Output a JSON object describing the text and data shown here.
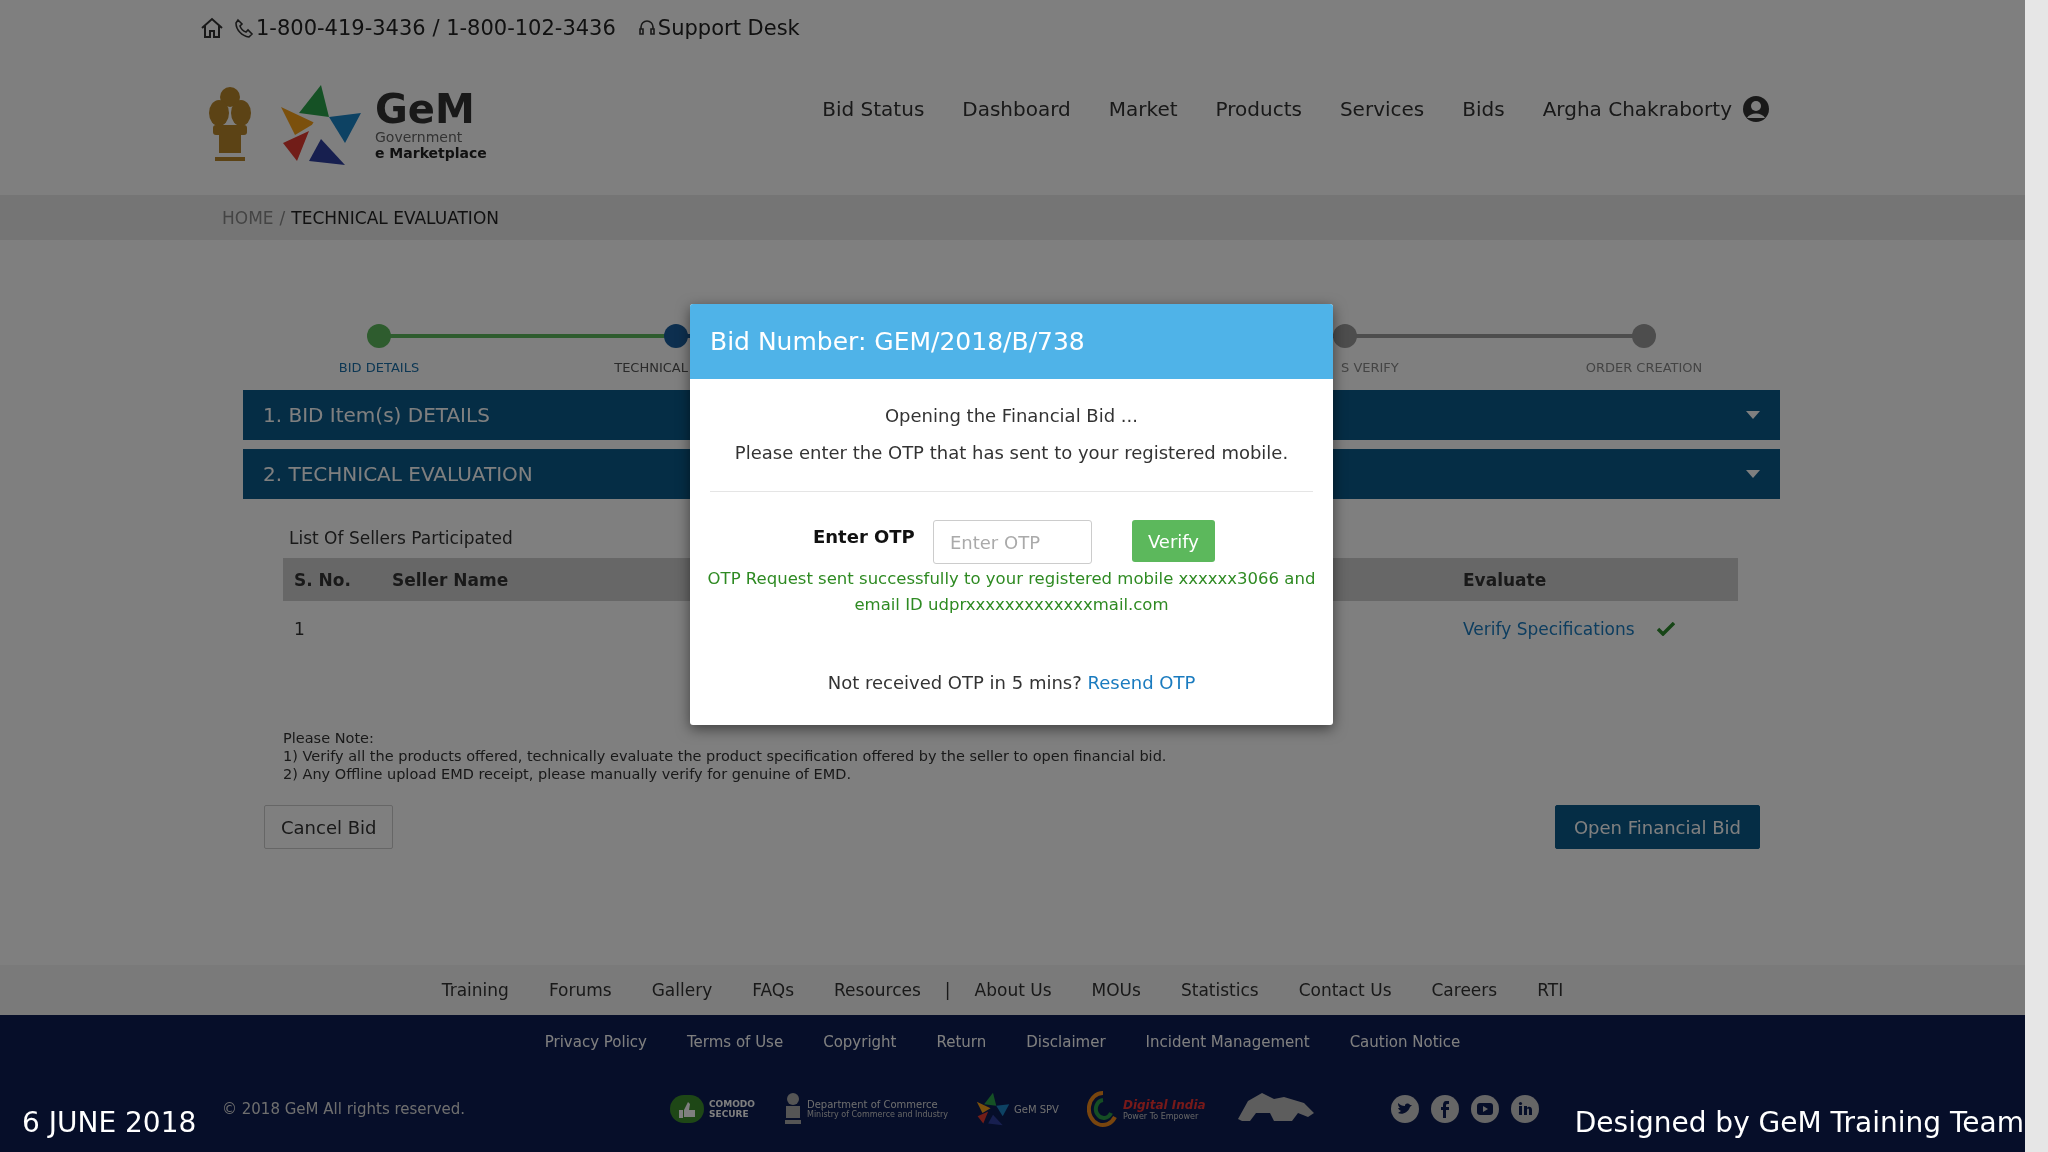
{
  "top_bar": {
    "phone": "1-800-419-3436 / 1-800-102-3436",
    "support": "Support Desk"
  },
  "logo": {
    "title": "GeM",
    "line_1": "Government",
    "line_2": "e Marketplace"
  },
  "nav": {
    "items": [
      "Bid Status",
      "Dashboard",
      "Market",
      "Products",
      "Services",
      "Bids"
    ],
    "user": "Argha Chakraborty"
  },
  "breadcrumb": {
    "separator": "/",
    "items": [
      {
        "label": "HOME",
        "current": false
      },
      {
        "label": "TECHNICAL EVALUATION",
        "current": true
      }
    ]
  },
  "stepper": [
    {
      "label": "BID DETAILS",
      "done": true,
      "current": false
    },
    {
      "label": "TECHNICAL",
      "done": false,
      "current": true
    },
    {
      "label": "S VERIFY",
      "done": false,
      "current": false
    },
    {
      "label": "ORDER CREATION",
      "done": false,
      "current": false
    }
  ],
  "sections": [
    "1. BID Item(s) DETAILS",
    "2. TECHNICAL EVALUATION"
  ],
  "sellers": {
    "title": "List Of Sellers Participated",
    "columns": [
      "S. No.",
      "Seller Name",
      "Evaluate"
    ],
    "rows": [
      {
        "s_no": "1",
        "evaluate": "Verify Specifications",
        "verified": true
      }
    ]
  },
  "notes": [
    "Please Note:",
    "1) Verify all the products offered, technically evaluate the product specification offered by the seller to open financial bid.",
    "2) Any Offline upload EMD receipt, please manually verify for genuine of EMD."
  ],
  "buttons": {
    "cancel": "Cancel Bid",
    "open": "Open Financial Bid"
  },
  "footer_links": [
    {
      "label": "Training",
      "kind": "link"
    },
    {
      "label": "Forums",
      "kind": "link"
    },
    {
      "label": "Gallery",
      "kind": "link"
    },
    {
      "label": "FAQs",
      "kind": "link"
    },
    {
      "label": "Resources",
      "kind": "link"
    },
    {
      "label": "|",
      "kind": "separator"
    },
    {
      "label": "About Us",
      "kind": "link"
    },
    {
      "label": "MOUs",
      "kind": "link"
    },
    {
      "label": "Statistics",
      "kind": "link"
    },
    {
      "label": "Contact Us",
      "kind": "link"
    },
    {
      "label": "Careers",
      "kind": "link"
    },
    {
      "label": "RTI",
      "kind": "link"
    }
  ],
  "legal_links": [
    "Privacy Policy",
    "Terms of Use",
    "Copyright",
    "Return",
    "Disclaimer",
    "Incident Management",
    "Caution Notice"
  ],
  "copyright": "© 2018 GeM All rights reserved.",
  "partners": [
    {
      "kind": "badge",
      "lines": [
        "COMODO",
        "SECURE"
      ]
    },
    {
      "kind": "emblem",
      "lines": [
        "Department of Commerce",
        "Ministry of Commerce and Industry"
      ]
    },
    {
      "kind": "star",
      "lines": [
        "GeM SPV"
      ]
    },
    {
      "kind": "swirl",
      "lines": [
        "Digital India",
        "Power To Empower"
      ]
    },
    {
      "kind": "lion"
    }
  ],
  "modal": {
    "title": "Bid Number: GEM/2018/B/738",
    "message": "Opening the Financial Bid ...",
    "instruction": "Please enter the OTP that has sent to your registered mobile.",
    "otp_label": "Enter OTP",
    "placeholder": "Enter OTP",
    "verify": "Verify",
    "status": "OTP Request sent successfully to your registered mobile xxxxxx3066 and email ID udprxxxxxxxxxxxxxmail.com",
    "resend_prompt": "Not received OTP in 5 mins?",
    "resend_link": "Resend OTP"
  },
  "captions": {
    "date": "6 JUNE 2018",
    "credit": "Designed by GeM Training Team"
  }
}
